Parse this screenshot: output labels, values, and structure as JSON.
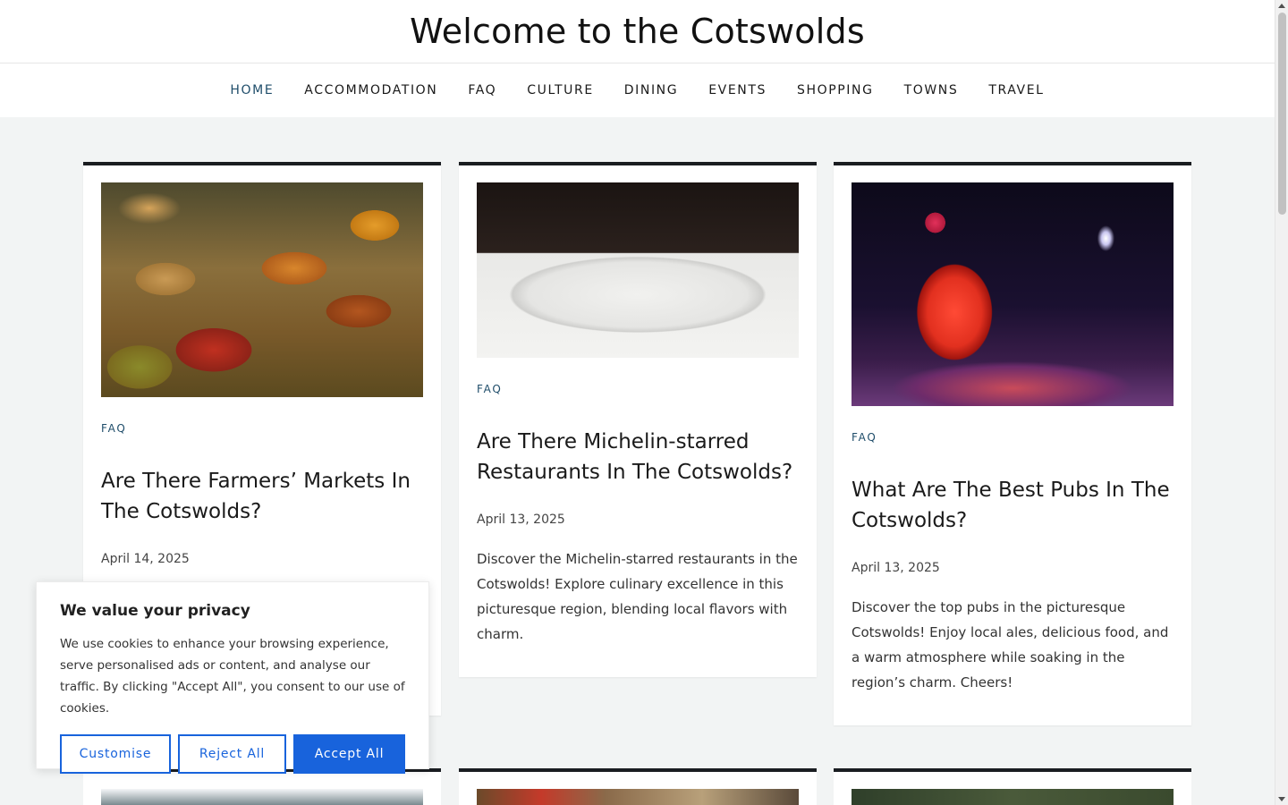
{
  "header": {
    "title": "Welcome to the Cotswolds"
  },
  "nav": {
    "items": [
      {
        "label": "HOME"
      },
      {
        "label": "ACCOMMODATION"
      },
      {
        "label": "FAQ"
      },
      {
        "label": "CULTURE"
      },
      {
        "label": "DINING"
      },
      {
        "label": "EVENTS"
      },
      {
        "label": "SHOPPING"
      },
      {
        "label": "TOWNS"
      },
      {
        "label": "TRAVEL"
      }
    ],
    "active": "HOME",
    "active_color": "#1f4d6a"
  },
  "posts": [
    {
      "category": "FAQ",
      "title": "Are There Farmers’ Markets In The Cotswolds?",
      "date": "April 14, 2025",
      "excerpt": "",
      "image": "spice-market-photo"
    },
    {
      "category": "FAQ",
      "title": "Are There Michelin-starred Restaurants In The Cotswolds?",
      "date": "April 13, 2025",
      "excerpt": "Discover the Michelin-starred restaurants in the Cotswolds! Explore culinary excellence in this picturesque region, blending local flavors with charm.",
      "image": "salmon-plate-photo"
    },
    {
      "category": "FAQ",
      "title": "What Are The Best Pubs In The Cotswolds?",
      "date": "April 13, 2025",
      "excerpt": "Discover the top pubs in the picturesque Cotswolds! Enjoy local ales, delicious food, and a warm atmosphere while soaking in the region’s charm. Cheers!",
      "image": "cocktail-photo"
    }
  ],
  "cookie_banner": {
    "title": "We value your privacy",
    "text": "We use cookies to enhance your browsing experience, serve personalised ads or content, and analyse our traffic. By clicking \"Accept All\", you consent to our use of cookies.",
    "customise_label": "Customise",
    "reject_label": "Reject All",
    "accept_label": "Accept All",
    "accent_color": "#1863dc"
  },
  "colors": {
    "card_border": "#1a1d21",
    "category": "#1f4d6a",
    "background": "#f2f4f4"
  }
}
